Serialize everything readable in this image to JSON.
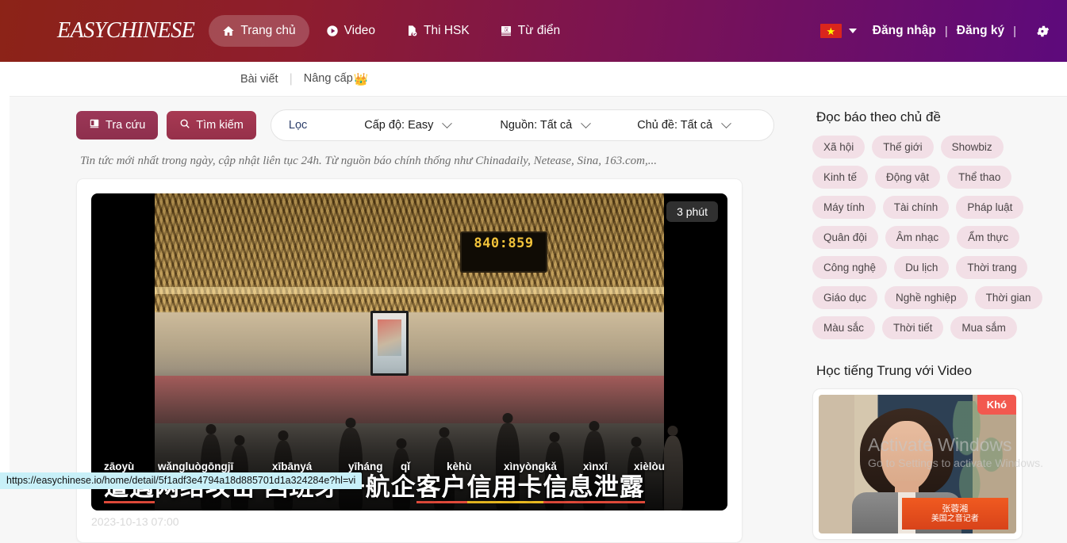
{
  "header": {
    "logo_part1": "EASY",
    "logo_part2": "CHINESE",
    "nav": [
      {
        "label": "Trang chủ",
        "icon": "home-icon",
        "active": true
      },
      {
        "label": "Video",
        "icon": "play-circle-icon",
        "active": false
      },
      {
        "label": "Thi HSK",
        "icon": "file-check-icon",
        "active": false
      },
      {
        "label": "Từ điển",
        "icon": "dictionary-book-icon",
        "active": false
      }
    ],
    "flag": "vietnam-flag",
    "flag_star": "★",
    "login_label": "Đăng nhập",
    "separator": "|",
    "register_label": "Đăng ký",
    "settings_icon": "gear-icon",
    "gradient_from": "#8c2317",
    "gradient_to": "#5d0a7c"
  },
  "subnav": {
    "items": [
      {
        "label": "Bài viết"
      },
      {
        "label": "Nâng cấp",
        "badge": "👑"
      }
    ],
    "separator": "|"
  },
  "toolbar": {
    "lookup_label": "Tra cứu",
    "lookup_icon": "book-icon",
    "search_label": "Tìm kiếm",
    "search_icon": "search-icon",
    "filter_label": "Lọc",
    "filters": [
      {
        "name": "level",
        "label": "Cấp độ:",
        "value": "Easy"
      },
      {
        "name": "source",
        "label": "Nguồn:",
        "value": "Tất cả"
      },
      {
        "name": "topic",
        "label": "Chủ đề:",
        "value": "Tất cả"
      }
    ]
  },
  "main": {
    "subtitle": "Tin tức mới nhất trong ngày, cập nhật liên tục 24h. Từ nguồn báo chính thống như Chinadaily, Netease, Sina, 163.com,...",
    "article": {
      "duration_badge": "3 phút",
      "board_number": "840:859",
      "pinyin": [
        "zāoyù",
        "wǎngluògōngjī",
        "xībānyá",
        "yīháng",
        "qǐ",
        "kèhù",
        "xìnyòngkǎ",
        "xìnxī",
        "xièlòu"
      ],
      "title_segments": [
        {
          "text": "遭遇",
          "underline": "red"
        },
        {
          "text": "网络攻击",
          "underline": "none"
        },
        {
          "text": " ",
          "underline": "none"
        },
        {
          "text": "西班牙",
          "underline": "none"
        },
        {
          "text": "一航企",
          "underline": "none"
        },
        {
          "text": "客户",
          "underline": "red"
        },
        {
          "text": "信用卡",
          "underline": "yellow"
        },
        {
          "text": "信息",
          "underline": "red"
        },
        {
          "text": "泄露",
          "underline": "red"
        }
      ],
      "title_full": "遭遇网络攻击 西班牙一航企客户信用卡信息泄露",
      "meta": "2023-10-13 07:00"
    }
  },
  "sidebar": {
    "topics_heading": "Đọc báo theo chủ đề",
    "topics": [
      "Xã hội",
      "Thế giới",
      "Showbiz",
      "Kinh tế",
      "Động vật",
      "Thể thao",
      "Máy tính",
      "Tài chính",
      "Pháp luật",
      "Quân đội",
      "Âm nhạc",
      "Ẩm thực",
      "Công nghệ",
      "Du lịch",
      "Thời trang",
      "Giáo dục",
      "Nghề nghiệp",
      "Thời gian",
      "Màu sắc",
      "Thời tiết",
      "Mua sắm"
    ],
    "video_heading": "Học tiếng Trung với Video",
    "video_card": {
      "difficulty_badge": "Khó",
      "caption_name": "张蓉湘",
      "caption_role": "美国之音记者"
    }
  },
  "watermark": {
    "line1": "Activate Windows",
    "line2": "Go to Settings to activate Windows."
  },
  "statusbar": {
    "url": "https://easychinese.io/home/detail/5f1adf3e4794a18d885701d1a324284e?hl=vi"
  }
}
